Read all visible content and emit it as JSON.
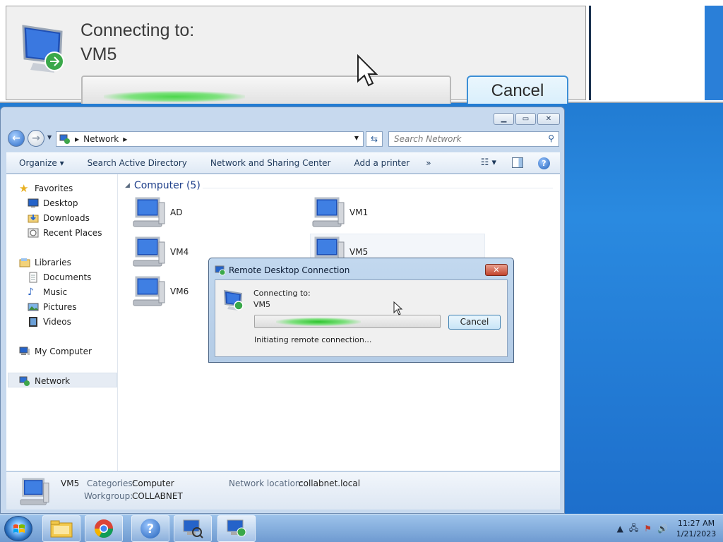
{
  "magnifier": {
    "line1": "Connecting to:",
    "line2": "VM5",
    "cancel_label": "Cancel"
  },
  "explorer": {
    "address": {
      "crumb": "Network",
      "search_placeholder": "Search Network"
    },
    "toolbar": {
      "organize": "Organize",
      "search_ad": "Search Active Directory",
      "network_sharing": "Network and Sharing Center",
      "add_printer": "Add a printer",
      "more": "»"
    },
    "nav": {
      "favorites": "Favorites",
      "desktop": "Desktop",
      "downloads": "Downloads",
      "recent": "Recent Places",
      "libraries": "Libraries",
      "documents": "Documents",
      "music": "Music",
      "pictures": "Pictures",
      "videos": "Videos",
      "my_computer": "My Computer",
      "network": "Network"
    },
    "group": {
      "title": "Computer (5)",
      "items": [
        "AD",
        "VM1",
        "VM4",
        "VM5",
        "VM6"
      ]
    },
    "details": {
      "name": "VM5",
      "categories_label": "Categories:",
      "categories_value": "Computer",
      "workgroup_label": "Workgroup:",
      "workgroup_value": "COLLABNET",
      "location_label": "Network location:",
      "location_value": "collabnet.local"
    }
  },
  "rdp_dialog": {
    "title": "Remote Desktop Connection",
    "line1": "Connecting to:",
    "line2": "VM5",
    "cancel_label": "Cancel",
    "status": "Initiating remote connection..."
  },
  "taskbar": {
    "time": "11:27 AM",
    "date": "1/21/2023"
  },
  "colors": {
    "desktop_blue": "#1c6cc9",
    "group_header": "#1e3f8a",
    "progress_green": "#2dc42d"
  }
}
